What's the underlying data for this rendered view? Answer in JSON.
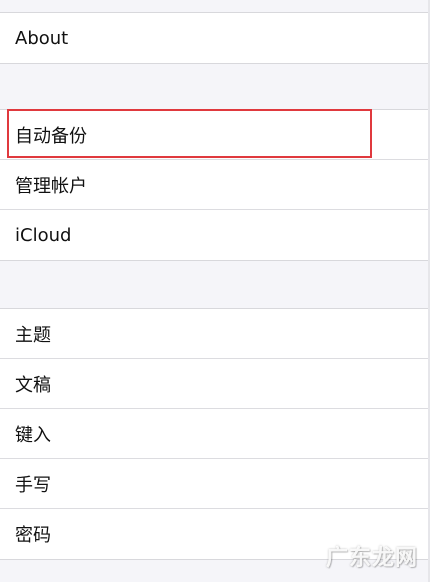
{
  "section1": {
    "items": [
      {
        "label": "About"
      }
    ]
  },
  "section2": {
    "items": [
      {
        "label": "自动备份"
      },
      {
        "label": "管理帐户"
      },
      {
        "label": "iCloud"
      }
    ]
  },
  "section3": {
    "items": [
      {
        "label": "主题"
      },
      {
        "label": "文稿"
      },
      {
        "label": "键入"
      },
      {
        "label": "手写"
      },
      {
        "label": "密码"
      }
    ]
  },
  "highlight_color": "#e0393e",
  "watermark_text": "广东龙网"
}
